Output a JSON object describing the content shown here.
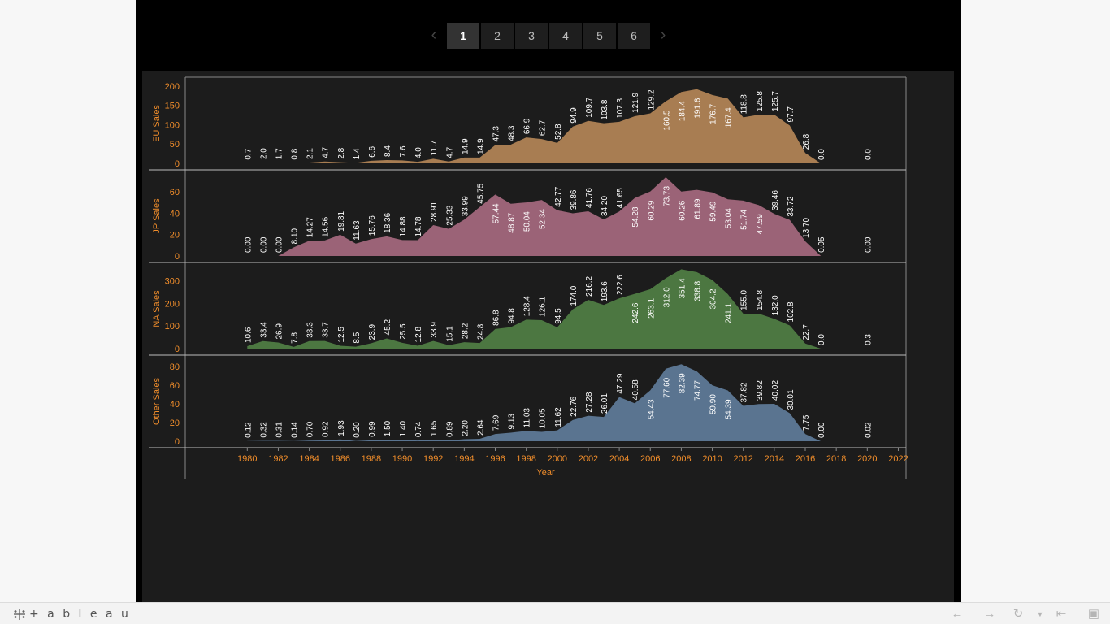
{
  "pager": {
    "pages": [
      "1",
      "2",
      "3",
      "4",
      "5",
      "6"
    ],
    "active_index": 0,
    "prev_icon": "chevron-left-icon",
    "next_icon": "chevron-right-icon"
  },
  "toolbar": {
    "logo_text": "+ a b l e a u",
    "icons": [
      "undo-icon",
      "redo-icon",
      "revert-icon",
      "revert-dropdown-icon",
      "reset-icon",
      "fullscreen-icon"
    ]
  },
  "colors": {
    "background": "#1c1c1c",
    "axis_label": "#f28e2b",
    "eu": "#a87d52",
    "jp": "#9b6377",
    "na": "#4c7741",
    "other": "#5a7490"
  },
  "chart_data": {
    "type": "area",
    "x_label": "Year",
    "x_ticks": [
      1980,
      1982,
      1984,
      1986,
      1988,
      1990,
      1992,
      1994,
      1996,
      1998,
      2000,
      2002,
      2004,
      2006,
      2008,
      2010,
      2012,
      2014,
      2016,
      2018,
      2020,
      2022
    ],
    "x_range": [
      1976,
      2022.5
    ],
    "years": [
      1980,
      1981,
      1982,
      1983,
      1984,
      1985,
      1986,
      1987,
      1988,
      1989,
      1990,
      1991,
      1992,
      1993,
      1994,
      1995,
      1996,
      1997,
      1998,
      1999,
      2000,
      2001,
      2002,
      2003,
      2004,
      2005,
      2006,
      2007,
      2008,
      2009,
      2010,
      2011,
      2012,
      2013,
      2014,
      2015,
      2016,
      2017,
      2020
    ],
    "panels": [
      {
        "name": "EU Sales",
        "y_label": "EU Sales",
        "y_ticks": [
          0,
          50,
          100,
          150,
          200
        ],
        "y_range": [
          0,
          210
        ],
        "color": "#a87d52",
        "values": [
          0.7,
          2.0,
          1.7,
          0.8,
          2.1,
          4.7,
          2.8,
          1.4,
          6.6,
          8.4,
          7.6,
          4.0,
          11.7,
          4.7,
          14.9,
          14.9,
          47.3,
          48.3,
          66.9,
          62.7,
          52.8,
          94.9,
          109.7,
          103.8,
          107.3,
          121.9,
          129.2,
          160.5,
          184.4,
          191.6,
          176.7,
          167.4,
          118.8,
          125.8,
          125.7,
          97.7,
          26.8,
          0.0,
          0.0
        ],
        "labels": [
          "0.7",
          "2.0",
          "1.7",
          "0.8",
          "2.1",
          "4.7",
          "2.8",
          "1.4",
          "6.6",
          "8.4",
          "7.6",
          "4.0",
          "11.7",
          "4.7",
          "14.9",
          "14.9",
          "47.3",
          "48.3",
          "66.9",
          "62.7",
          "52.8",
          "94.9",
          "109.7",
          "103.8",
          "107.3",
          "121.9",
          "129.2",
          "160.5",
          "184.4",
          "191.6",
          "176.7",
          "167.4",
          "118.8",
          "125.8",
          "125.7",
          "97.7",
          "26.8",
          "0.0",
          "0.0"
        ]
      },
      {
        "name": "JP Sales",
        "y_label": "JP Sales",
        "y_ticks": [
          0,
          20,
          40,
          60
        ],
        "y_range": [
          0,
          76
        ],
        "color": "#9b6377",
        "values": [
          0.0,
          0.0,
          0.0,
          8.1,
          14.27,
          14.56,
          19.81,
          11.63,
          15.76,
          18.36,
          14.88,
          14.78,
          28.91,
          25.33,
          33.99,
          45.75,
          57.44,
          48.87,
          50.04,
          52.34,
          42.77,
          39.86,
          41.76,
          34.2,
          41.65,
          54.28,
          60.29,
          73.73,
          60.26,
          61.89,
          59.49,
          53.04,
          51.74,
          47.59,
          39.46,
          33.72,
          13.7,
          0.05,
          0.0
        ],
        "labels": [
          "0.00",
          "0.00",
          "0.00",
          "8.10",
          "14.27",
          "14.56",
          "19.81",
          "11.63",
          "15.76",
          "18.36",
          "14.88",
          "14.78",
          "28.91",
          "25.33",
          "33.99",
          "45.75",
          "57.44",
          "48.87",
          "50.04",
          "52.34",
          "42.77",
          "39.86",
          "41.76",
          "34.20",
          "41.65",
          "54.28",
          "60.29",
          "73.73",
          "60.26",
          "61.89",
          "59.49",
          "53.04",
          "51.74",
          "47.59",
          "39.46",
          "33.72",
          "13.70",
          "0.05",
          "0.00"
        ]
      },
      {
        "name": "NA Sales",
        "y_label": "NA Sales",
        "y_ticks": [
          0,
          100,
          200,
          300
        ],
        "y_range": [
          0,
          360
        ],
        "color": "#4c7741",
        "values": [
          10.6,
          33.4,
          26.9,
          7.8,
          33.3,
          33.7,
          12.5,
          8.5,
          23.9,
          45.2,
          25.5,
          12.8,
          33.9,
          15.1,
          28.2,
          24.8,
          86.8,
          94.8,
          128.4,
          126.1,
          94.5,
          174.0,
          216.2,
          193.6,
          222.6,
          242.6,
          263.1,
          312.0,
          351.4,
          338.8,
          304.2,
          241.1,
          155.0,
          154.8,
          132.0,
          102.8,
          22.7,
          0.0,
          0.3
        ],
        "labels": [
          "10.6",
          "33.4",
          "26.9",
          "7.8",
          "33.3",
          "33.7",
          "12.5",
          "8.5",
          "23.9",
          "45.2",
          "25.5",
          "12.8",
          "33.9",
          "15.1",
          "28.2",
          "24.8",
          "86.8",
          "94.8",
          "128.4",
          "126.1",
          "94.5",
          "174.0",
          "216.2",
          "193.6",
          "222.6",
          "242.6",
          "263.1",
          "312.0",
          "351.4",
          "338.8",
          "304.2",
          "241.1",
          "155.0",
          "154.8",
          "132.0",
          "102.8",
          "22.7",
          "0.0",
          "0.3"
        ]
      },
      {
        "name": "Other Sales",
        "y_label": "Other Sales",
        "y_ticks": [
          0,
          20,
          40,
          60,
          80
        ],
        "y_range": [
          0,
          87
        ],
        "color": "#5a7490",
        "values": [
          0.12,
          0.32,
          0.31,
          0.14,
          0.7,
          0.92,
          1.93,
          0.2,
          0.99,
          1.5,
          1.4,
          0.74,
          1.65,
          0.89,
          2.2,
          2.64,
          7.69,
          9.13,
          11.03,
          10.05,
          11.62,
          22.76,
          27.28,
          26.01,
          47.29,
          40.58,
          54.43,
          77.6,
          82.39,
          74.77,
          59.9,
          54.39,
          37.82,
          39.82,
          40.02,
          30.01,
          7.75,
          0.0,
          0.02
        ],
        "labels": [
          "0.12",
          "0.32",
          "0.31",
          "0.14",
          "0.70",
          "0.92",
          "1.93",
          "0.20",
          "0.99",
          "1.50",
          "1.40",
          "0.74",
          "1.65",
          "0.89",
          "2.20",
          "2.64",
          "7.69",
          "9.13",
          "11.03",
          "10.05",
          "11.62",
          "22.76",
          "27.28",
          "26.01",
          "47.29",
          "40.58",
          "54.43",
          "77.60",
          "82.39",
          "74.77",
          "59.90",
          "54.39",
          "37.82",
          "39.82",
          "40.02",
          "30.01",
          "7.75",
          "0.00",
          "0.02"
        ]
      }
    ]
  }
}
